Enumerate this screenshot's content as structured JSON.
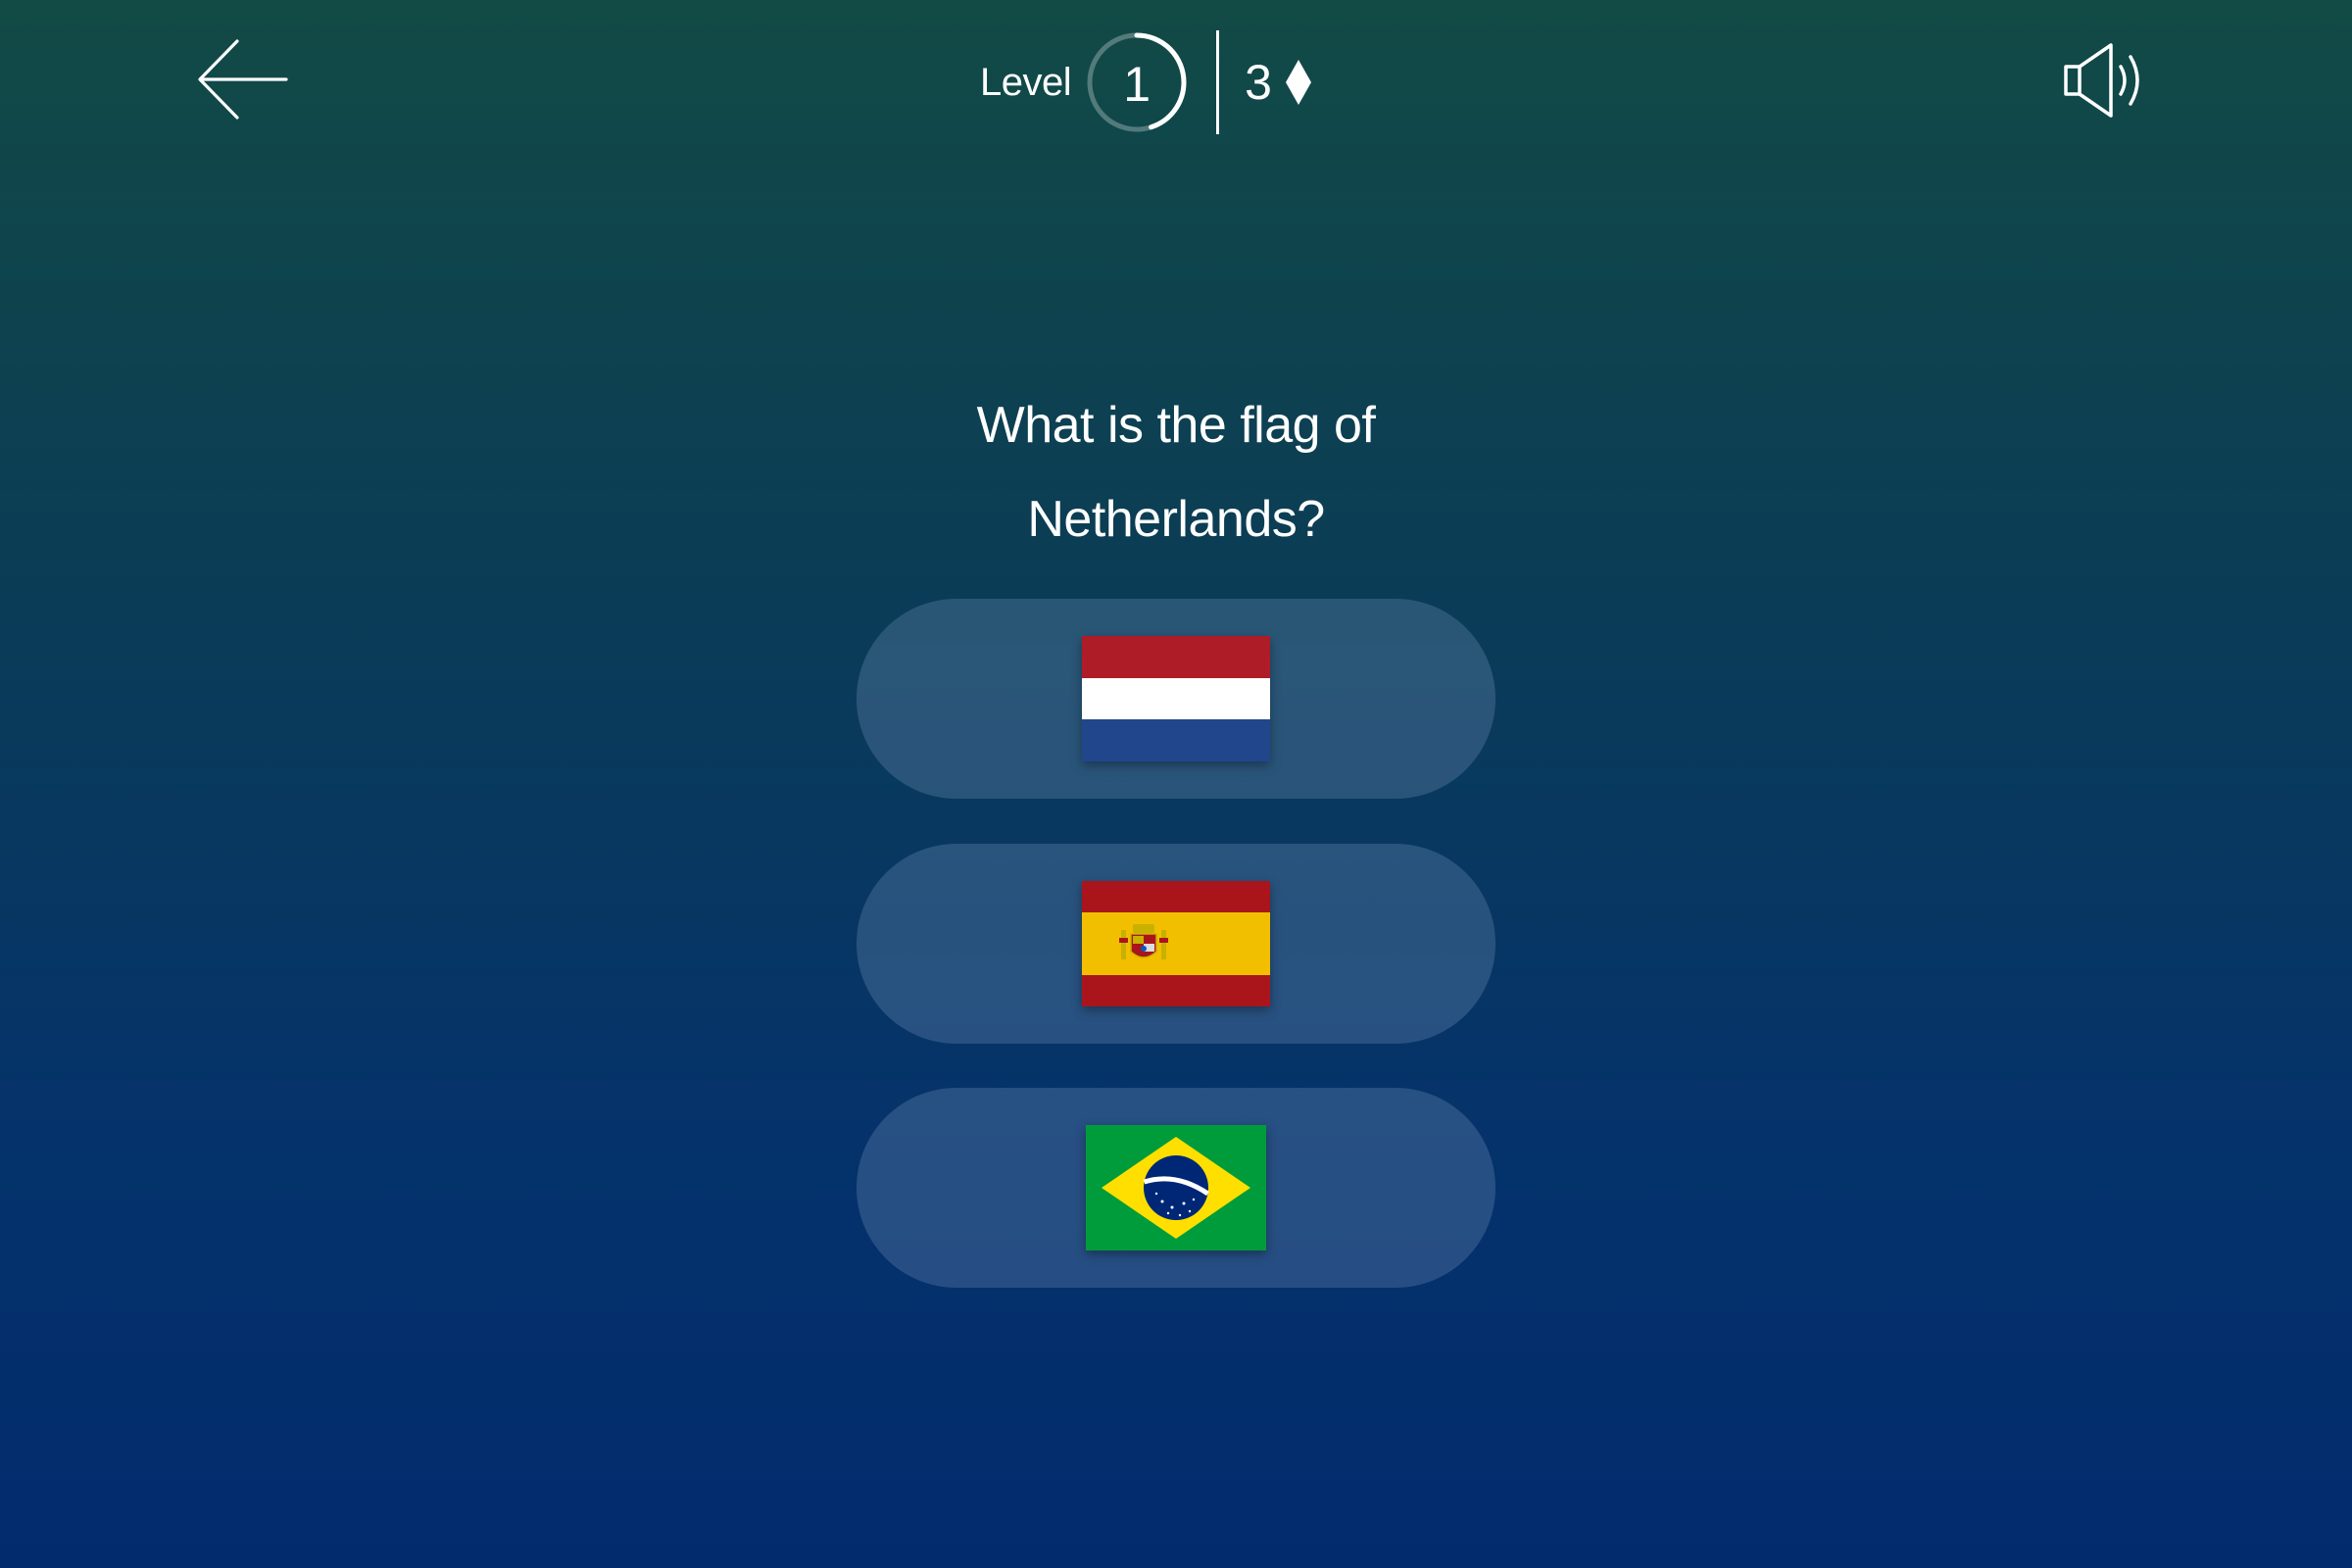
{
  "header": {
    "back_icon": "arrow-left-icon",
    "level_label": "Level",
    "level_number": "1",
    "level_progress": 0.45,
    "gem_count": "3",
    "gem_icon": "diamond-icon",
    "sound_icon": "speaker-icon"
  },
  "question": {
    "line1": "What is the flag of",
    "line2": "Netherlands?"
  },
  "answers": [
    {
      "flag": "netherlands-flag",
      "colors": [
        "#ae1c28",
        "#ffffff",
        "#21468b"
      ]
    },
    {
      "flag": "spain-flag",
      "colors": [
        "#aa151b",
        "#f1bf00"
      ]
    },
    {
      "flag": "brazil-flag",
      "colors": [
        "#009c3b",
        "#ffdf00",
        "#002776"
      ]
    }
  ],
  "colors": {
    "background_top": "#124a46",
    "background_bottom": "#022b6e",
    "answer_pill": "rgba(120,150,190,0.30)",
    "text": "#ffffff"
  }
}
